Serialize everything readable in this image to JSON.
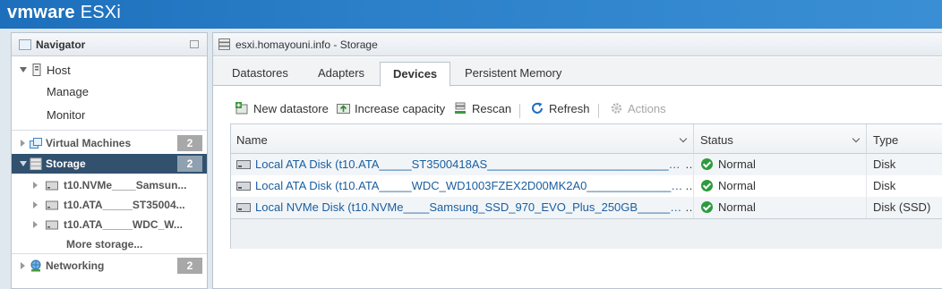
{
  "header": {
    "brand": "vmware",
    "product": "ESXi"
  },
  "navigator": {
    "title": "Navigator",
    "host": {
      "label": "Host",
      "children": [
        "Manage",
        "Monitor"
      ]
    },
    "virtual_machines": {
      "label": "Virtual Machines",
      "count": "2"
    },
    "storage": {
      "label": "Storage",
      "count": "2",
      "children": [
        "t10.NVMe____Samsun...",
        "t10.ATA_____ST35004...",
        "t10.ATA_____WDC_W..."
      ],
      "more": "More storage..."
    },
    "networking": {
      "label": "Networking",
      "count": "2"
    }
  },
  "main": {
    "title": "esxi.homayouni.info - Storage",
    "tabs": [
      "Datastores",
      "Adapters",
      "Devices",
      "Persistent Memory"
    ],
    "active_tab": "Devices",
    "toolbar": {
      "new_datastore": "New datastore",
      "increase_capacity": "Increase capacity",
      "rescan": "Rescan",
      "refresh": "Refresh",
      "actions": "Actions"
    },
    "table": {
      "columns": [
        "Name",
        "Status",
        "Type"
      ],
      "rows": [
        {
          "name": "Local ATA Disk (t10.ATA_____ST3500418AS_________________________________________",
          "status": "Normal",
          "type": "Disk"
        },
        {
          "name": "Local ATA Disk (t10.ATA_____WDC_WD1003FZEX2D00MK2A0_____________________________",
          "status": "Normal",
          "type": "Disk"
        },
        {
          "name": "Local NVMe Disk (t10.NVMe____Samsung_SSD_970_EVO_Plus_250GB_________________________",
          "status": "Normal",
          "type": "Disk (SSD)"
        }
      ]
    }
  },
  "colors": {
    "header_blue": "#1d6fbb",
    "selected_nav": "#32516f",
    "link_blue": "#1a5fa0",
    "status_ok": "#2d9b3d",
    "badge_gray": "#a8a8a8"
  }
}
